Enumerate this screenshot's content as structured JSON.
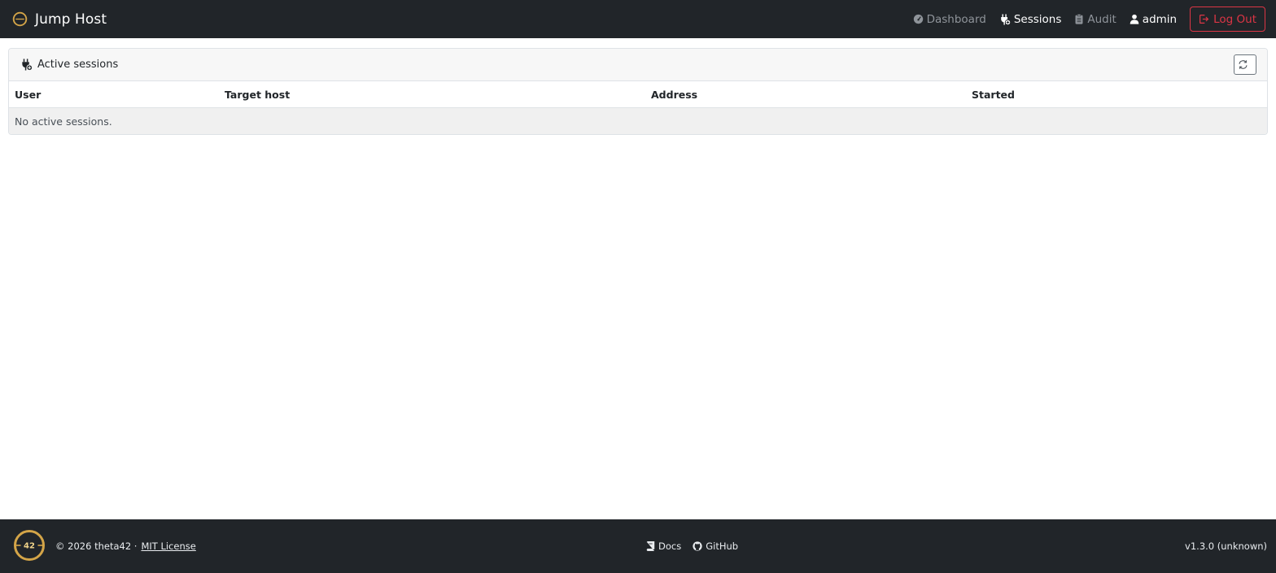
{
  "navbar": {
    "brand": "Jump Host",
    "links": {
      "dashboard": "Dashboard",
      "sessions": "Sessions",
      "audit": "Audit",
      "user": "admin"
    },
    "logout_label": "Log Out"
  },
  "card": {
    "title": "Active sessions",
    "columns": [
      "User",
      "Target host",
      "Address",
      "Started"
    ],
    "empty_message": "No active sessions."
  },
  "footer": {
    "logo_text": "42",
    "copyright": "© 2026 theta42 ·",
    "license_label": "MIT License",
    "links": {
      "docs": "Docs",
      "github": "GitHub"
    },
    "version": "v1.3.0 (unknown)"
  },
  "colors": {
    "navbar_bg": "#212529",
    "logout": "#dc3545",
    "gold": "#d4a548"
  },
  "icons": {
    "brand": "theta-logo-icon",
    "dashboard": "speedometer-icon",
    "sessions": "plug-icon",
    "audit": "clipboard-icon",
    "user": "person-icon",
    "logout": "box-arrow-right-icon",
    "refresh": "arrow-repeat-icon",
    "docs": "book-icon",
    "github": "github-icon"
  }
}
